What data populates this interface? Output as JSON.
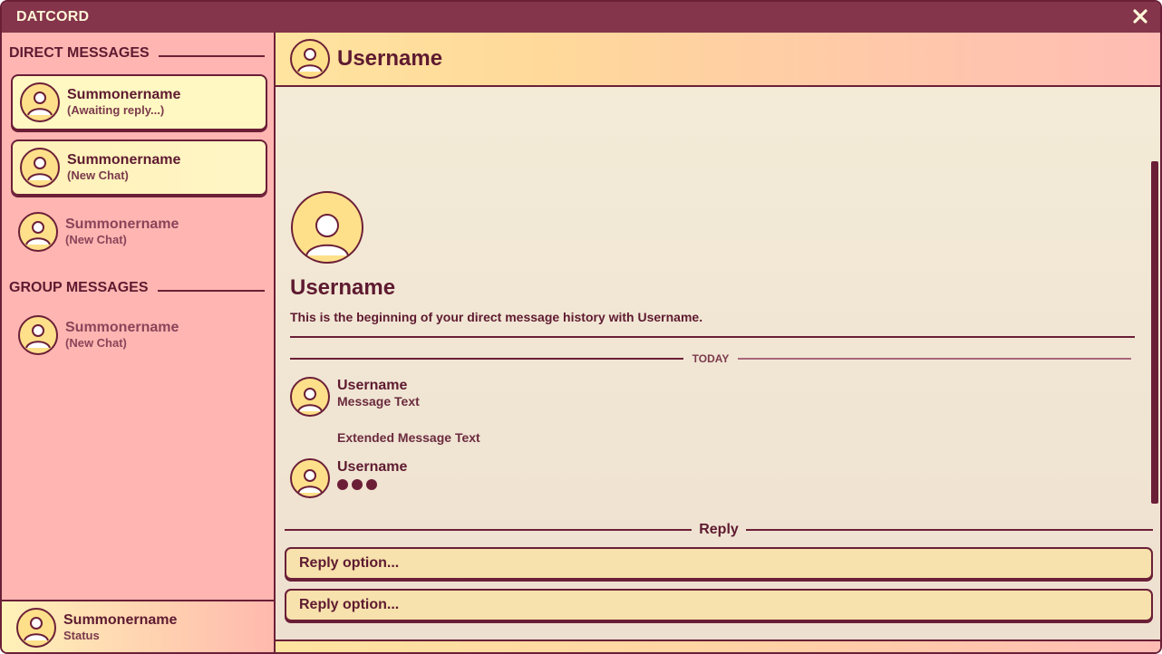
{
  "app": {
    "title": "DATCORD"
  },
  "sidebar": {
    "direct_heading": "DIRECT MESSAGES",
    "group_heading": "GROUP MESSAGES",
    "direct_items": [
      {
        "name": "Summonername",
        "status": "(Awaiting reply...)"
      },
      {
        "name": "Summonername",
        "status": "(New Chat)"
      },
      {
        "name": "Summonername",
        "status": "(New Chat)"
      }
    ],
    "group_items": [
      {
        "name": "Summonername",
        "status": "(New Chat)"
      }
    ],
    "current_user": {
      "name": "Summonername",
      "status": "Status"
    }
  },
  "chat": {
    "header_name": "Username",
    "intro_name": "Username",
    "intro_text": "This is the beginning of your direct message history with Username.",
    "divider_label": "TODAY",
    "messages": [
      {
        "author": "Username",
        "text": "Message Text",
        "extended": "Extended Message Text"
      },
      {
        "author": "Username",
        "typing": true
      }
    ],
    "reply_label": "Reply",
    "reply_options": [
      "Reply option...",
      "Reply option..."
    ]
  },
  "colors": {
    "primary": "#6b1f37",
    "titlebar": "#84344b",
    "sidebar_bg": "#ffb6b2",
    "card_bg": "#fff1b8",
    "avatar_fill": "#ffe08a",
    "reply_option_bg": "#f7e1ac"
  },
  "icons": {
    "avatar": "user-avatar-icon",
    "close": "close-icon",
    "typing": "typing-dots-icon"
  }
}
